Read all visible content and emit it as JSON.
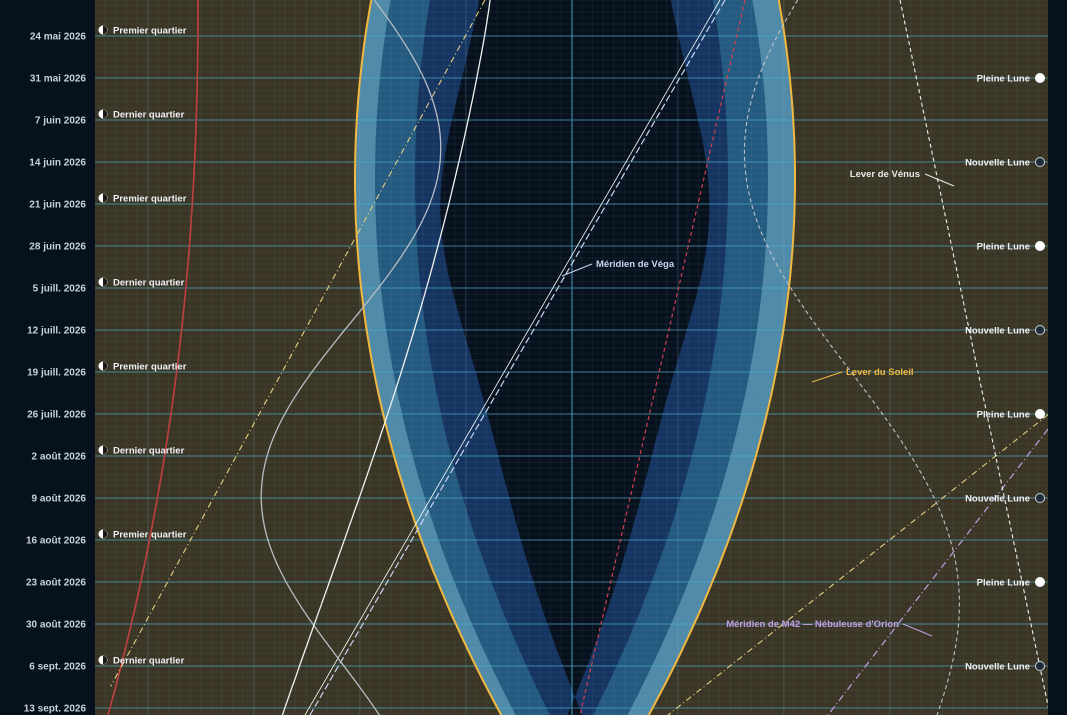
{
  "chart_data": {
    "type": "line",
    "title": "",
    "colors": {
      "night": "#07111d",
      "day": "#3a3524",
      "twilight_civil": "#4f8aa8",
      "twilight_nautical": "#245a80",
      "twilight_astro": "#153460",
      "sun": "#f0b840",
      "sun_label": "#f0b840",
      "venus": "#e8e8e8",
      "vega": "#c8d4f0",
      "m42": "#c0a0e0",
      "moon_track": "#c04040"
    },
    "y_axis": {
      "label": "",
      "ticks": [
        "24 mai 2026",
        "31 mai 2026",
        "7 juin 2026",
        "14 juin 2026",
        "21 juin 2026",
        "28 juin 2026",
        "5 juill. 2026",
        "12 juill. 2026",
        "19 juill. 2026",
        "26 juill. 2026",
        "2 août 2026",
        "9 août 2026",
        "16 août 2026",
        "23 août 2026",
        "30 août 2026",
        "6 sept. 2026",
        "13 sept. 2026"
      ]
    },
    "moon_phases_left": [
      {
        "date": "24 mai 2026",
        "label": "Premier quartier"
      },
      {
        "date": "7 juin 2026",
        "label": "Dernier quartier"
      },
      {
        "date": "21 juin 2026",
        "label": "Premier quartier"
      },
      {
        "date": "5 juill. 2026",
        "label": "Dernier quartier"
      },
      {
        "date": "19 juill. 2026",
        "label": "Premier quartier"
      },
      {
        "date": "2 août 2026",
        "label": "Dernier quartier"
      },
      {
        "date": "16 août 2026",
        "label": "Premier quartier"
      },
      {
        "date": "6 sept. 2026",
        "label": "Dernier quartier"
      }
    ],
    "moon_phases_right": [
      {
        "date": "31 mai 2026",
        "label": "Pleine Lune",
        "full": true
      },
      {
        "date": "14 juin 2026",
        "label": "Nouvelle Lune",
        "full": false
      },
      {
        "date": "28 juin 2026",
        "label": "Pleine Lune",
        "full": true
      },
      {
        "date": "12 juill. 2026",
        "label": "Nouvelle Lune",
        "full": false
      },
      {
        "date": "26 juill. 2026",
        "label": "Pleine Lune",
        "full": true
      },
      {
        "date": "9 août 2026",
        "label": "Nouvelle Lune",
        "full": false
      },
      {
        "date": "23 août 2026",
        "label": "Pleine Lune",
        "full": true
      },
      {
        "date": "6 sept. 2026",
        "label": "Nouvelle Lune",
        "full": false
      }
    ],
    "annotations": {
      "vega": "Méridien de Véga",
      "venus": "Lever de Vénus",
      "sun": "Lever du Soleil",
      "m42": "Méridien de M42 — Nébuleuse d'Orion"
    }
  }
}
